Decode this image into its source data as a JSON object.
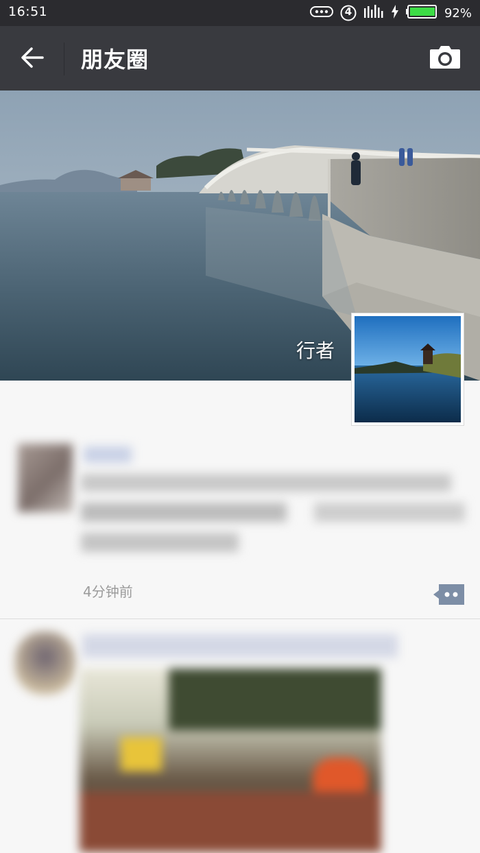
{
  "status_bar": {
    "time": "16:51",
    "battery_percent": "92%",
    "notification_count": "4",
    "icons": [
      "more-dots-icon",
      "notification-badge-icon",
      "signal-icon",
      "charging-icon",
      "battery-icon"
    ]
  },
  "header": {
    "title": "朋友圈",
    "back_icon": "arrow-left-icon",
    "camera_icon": "camera-icon"
  },
  "profile": {
    "nickname": "行者"
  },
  "feed": {
    "posts": [
      {
        "time": "4分钟前",
        "comment_icon": "comment-dots-icon"
      },
      {
        "time": ""
      }
    ]
  },
  "colors": {
    "status_bar_bg": "#2b2b2f",
    "header_bg": "#393a3f",
    "page_bg": "#f7f7f7",
    "comment_btn": "#7d8ea6",
    "battery_fill": "#3ddc46"
  }
}
